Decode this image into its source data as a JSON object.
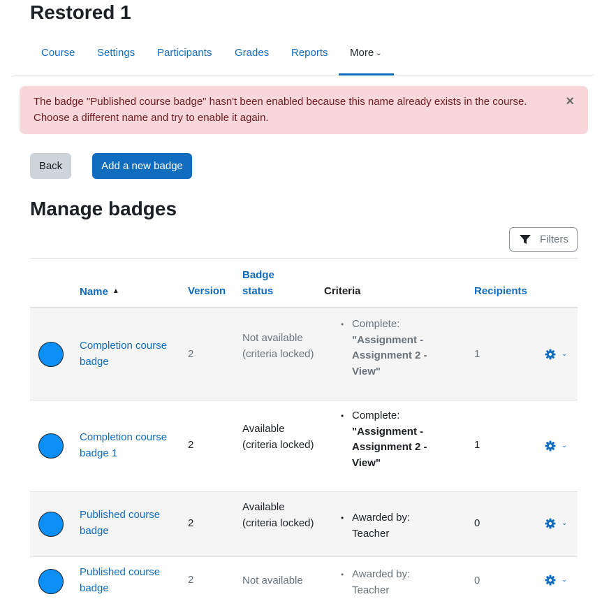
{
  "course_title": "Restored 1",
  "nav": {
    "items": [
      {
        "label": "Course"
      },
      {
        "label": "Settings"
      },
      {
        "label": "Participants"
      },
      {
        "label": "Grades"
      },
      {
        "label": "Reports"
      },
      {
        "label": "More"
      }
    ],
    "active": "More"
  },
  "alert": {
    "message": "The badge \"Published course badge\" hasn't been enabled because this name already exists in the course. Choose a different name and try to enable it again.",
    "close_symbol": "×"
  },
  "buttons": {
    "back": "Back",
    "add": "Add a new badge"
  },
  "section_title": "Manage badges",
  "filters_label": "Filters",
  "table": {
    "headers": {
      "name": "Name",
      "version": "Version",
      "status_line1": "Badge",
      "status_line2": "status",
      "criteria": "Criteria",
      "recipients": "Recipients"
    },
    "rows": [
      {
        "name": "Completion course badge",
        "version": "2",
        "status": "Not available (criteria locked)",
        "criteria_prefix": "Complete:",
        "criteria_bold": "\"Assignment - Assignment 2 - View\"",
        "recipients": "1"
      },
      {
        "name": "Completion course badge 1",
        "version": "2",
        "status": "Available (criteria locked)",
        "criteria_prefix": "Complete:",
        "criteria_bold": "\"Assignment - Assignment 2 - View\"",
        "recipients": "1"
      },
      {
        "name": "Published course badge",
        "version": "2",
        "status": "Available (criteria locked)",
        "criteria_prefix": "Awarded by: Teacher",
        "criteria_bold": "",
        "recipients": "0"
      },
      {
        "name": "Published course badge",
        "version": "2",
        "status": "Not available",
        "criteria_prefix": "Awarded by: Teacher",
        "criteria_bold": "",
        "recipients": "0"
      }
    ]
  },
  "colors": {
    "link": "#0f6cbf",
    "badge_fill": "#0b8ff5",
    "alert_bg": "#f8d7da",
    "alert_text": "#6e1a20"
  }
}
